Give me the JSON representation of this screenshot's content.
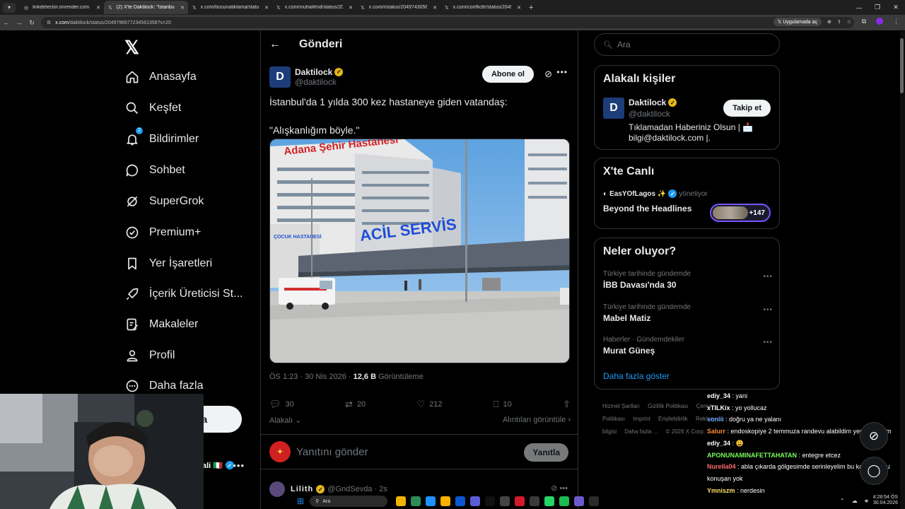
{
  "browser": {
    "tabs": [
      {
        "label": "linkdetector.onrender.com",
        "active": false
      },
      {
        "label": "(2) X'te Daktilock: \"İstanbul'da",
        "active": true
      },
      {
        "label": "x.com/bosunatiklama/status/20",
        "active": false
      },
      {
        "label": "x.com/muhalifmd/status/20497",
        "active": false
      },
      {
        "label": "x.com/i/status/20497430567",
        "active": false
      },
      {
        "label": "x.com/conflicttr/status/204978",
        "active": false
      }
    ],
    "url_host": "x.com",
    "url_path": "/daktilock/status/2049796677234561358?s=20",
    "app_button": "Uygulamada aç"
  },
  "nav": {
    "logo": "𝕏",
    "items": [
      {
        "label": "Anasayfa",
        "icon": "home-icon"
      },
      {
        "label": "Keşfet",
        "icon": "search-icon"
      },
      {
        "label": "Bildirimler",
        "icon": "bell-icon",
        "badge": "2"
      },
      {
        "label": "Sohbet",
        "icon": "chat-icon"
      },
      {
        "label": "SuperGrok",
        "icon": "grok-icon"
      },
      {
        "label": "Premium+",
        "icon": "premium-icon"
      },
      {
        "label": "Yer İşaretleri",
        "icon": "bookmark-icon"
      },
      {
        "label": "İçerik Üreticisi St...",
        "icon": "rocket-icon"
      },
      {
        "label": "Makaleler",
        "icon": "articles-icon"
      },
      {
        "label": "Profil",
        "icon": "profile-icon"
      },
      {
        "label": "Daha fazla",
        "icon": "more-circle-icon"
      }
    ],
    "post_button": "nla",
    "account_name": "ali 🇮🇹"
  },
  "main": {
    "header_title": "Gönderi",
    "author": {
      "name": "Daktilock",
      "handle": "@daktilock",
      "avatar_letter": "D"
    },
    "subscribe": "Abone ol",
    "text_line1": "İstanbul'da 1 yılda 300 kez hastaneye giden vatandaş:",
    "text_line2": "\"Alışkanlığım böyle.\"",
    "sign_main": "Adana Şehir Hastanesi",
    "sign_acil": "ACİL SERVİS",
    "sign_side": "ÇOCUK HASTANESİ",
    "meta_time": "ÖS 1:23 · 30 Nis 2026 · ",
    "views": "12,6 B",
    "views_label": " Görüntüleme",
    "actions": {
      "replies": "30",
      "reposts": "20",
      "likes": "212",
      "bookmarks": "10"
    },
    "relevance": "Alakalı",
    "quotes_link": "Alıntıları görüntüle",
    "reply_placeholder": "Yanıtını gönder",
    "reply_button": "Yanıtla",
    "next_tweet": {
      "name": "Lilith",
      "handle": "@GndSevda · 2s"
    }
  },
  "right": {
    "search_placeholder": "Ara",
    "related": {
      "title": "Alakalı kişiler",
      "name": "Daktilock",
      "handle": "@daktilock",
      "bio": "Tıklamadan Haberiniz Olsun | 📩 bilgi@daktilock.com |.",
      "follow": "Takip et"
    },
    "live": {
      "title": "X'te Canlı",
      "host": "EasYOfLagos ✨",
      "role": "yönetiyor",
      "show": "Beyond the Headlines",
      "count": "+147"
    },
    "trends": {
      "title": "Neler oluyor?",
      "items": [
        {
          "context": "Türkiye tarihinde gündemde",
          "name": "İBB Davası'nda 30"
        },
        {
          "context": "Türkiye tarihinde gündemde",
          "name": "Mabel Matiz"
        },
        {
          "context": "Haberler · Gündemdekiler",
          "name": "Murat Güneş"
        }
      ],
      "show_more": "Daha fazla göster"
    },
    "footer": [
      "Hizmet Şartları",
      "Gizlilik Politikası",
      "Çerez Politikası",
      "Imprint",
      "Erişilebilirlik",
      "Reklam bilgisi",
      "Daha fazla ...",
      "© 2026 X Corp."
    ]
  },
  "chat": [
    {
      "user": "ediy_34",
      "color": "#ffffff",
      "text": "yani"
    },
    {
      "user": "xTILKix",
      "color": "#ffffff",
      "text": "yo yollucaz"
    },
    {
      "user": "sonlii",
      "color": "#6fa8ff",
      "text": "doğru ya ne yalanı"
    },
    {
      "user": "Salurr",
      "color": "#ff8c3a",
      "text": "endoskopiye 2 temmuza randevu alabildim yemin ederim",
      "wrap": true
    },
    {
      "user": "ediy_34",
      "color": "#ffffff",
      "text": "😩"
    },
    {
      "user": "APONUNAMINAFETTAHATAN",
      "color": "#7cfc5c",
      "text": "entegre etcez"
    },
    {
      "user": "Nurella04",
      "color": "#ff6b6b",
      "text": "abla çıkarda gölgesimde serinleyelim bu kadar doğru konuşan yok",
      "wrap": true
    },
    {
      "user": "Ymniszm",
      "color": "#ffe066",
      "text": "nerdesin"
    }
  ],
  "taskbar": {
    "search": "Ara",
    "time": "4:28:54 ÖS",
    "date": "30.04.2026"
  }
}
